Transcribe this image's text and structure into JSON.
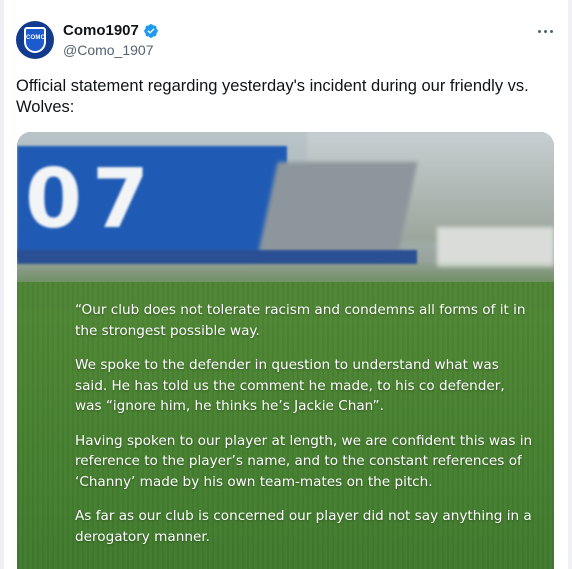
{
  "author": {
    "display_name": "Como1907",
    "handle": "@Como_1907",
    "verified": true,
    "avatar_crest_text": "COMO",
    "verified_badge_color": "#1d9bf0"
  },
  "post": {
    "text": "Official statement regarding yesterday's incident during our friendly vs. Wolves:"
  },
  "media": {
    "stadium_digits": "07",
    "statement_paragraphs": [
      "“Our club does not tolerate racism and condemns all forms of it in the strongest possible way.",
      "We spoke to the defender in question to understand what was said. He has told us the comment he made, to his co defender, was “ignore him, he thinks he’s Jackie Chan”.",
      "Having spoken to our player at length, we are confident this was in reference to the player’s name, and to the constant references of ‘Channy’ made by his own team-mates on the pitch.",
      "As far as our club is concerned our player did not say anything in a derogatory manner."
    ]
  },
  "icons": {
    "more": "more-horizontal-icon",
    "verified": "verified-badge-icon"
  }
}
